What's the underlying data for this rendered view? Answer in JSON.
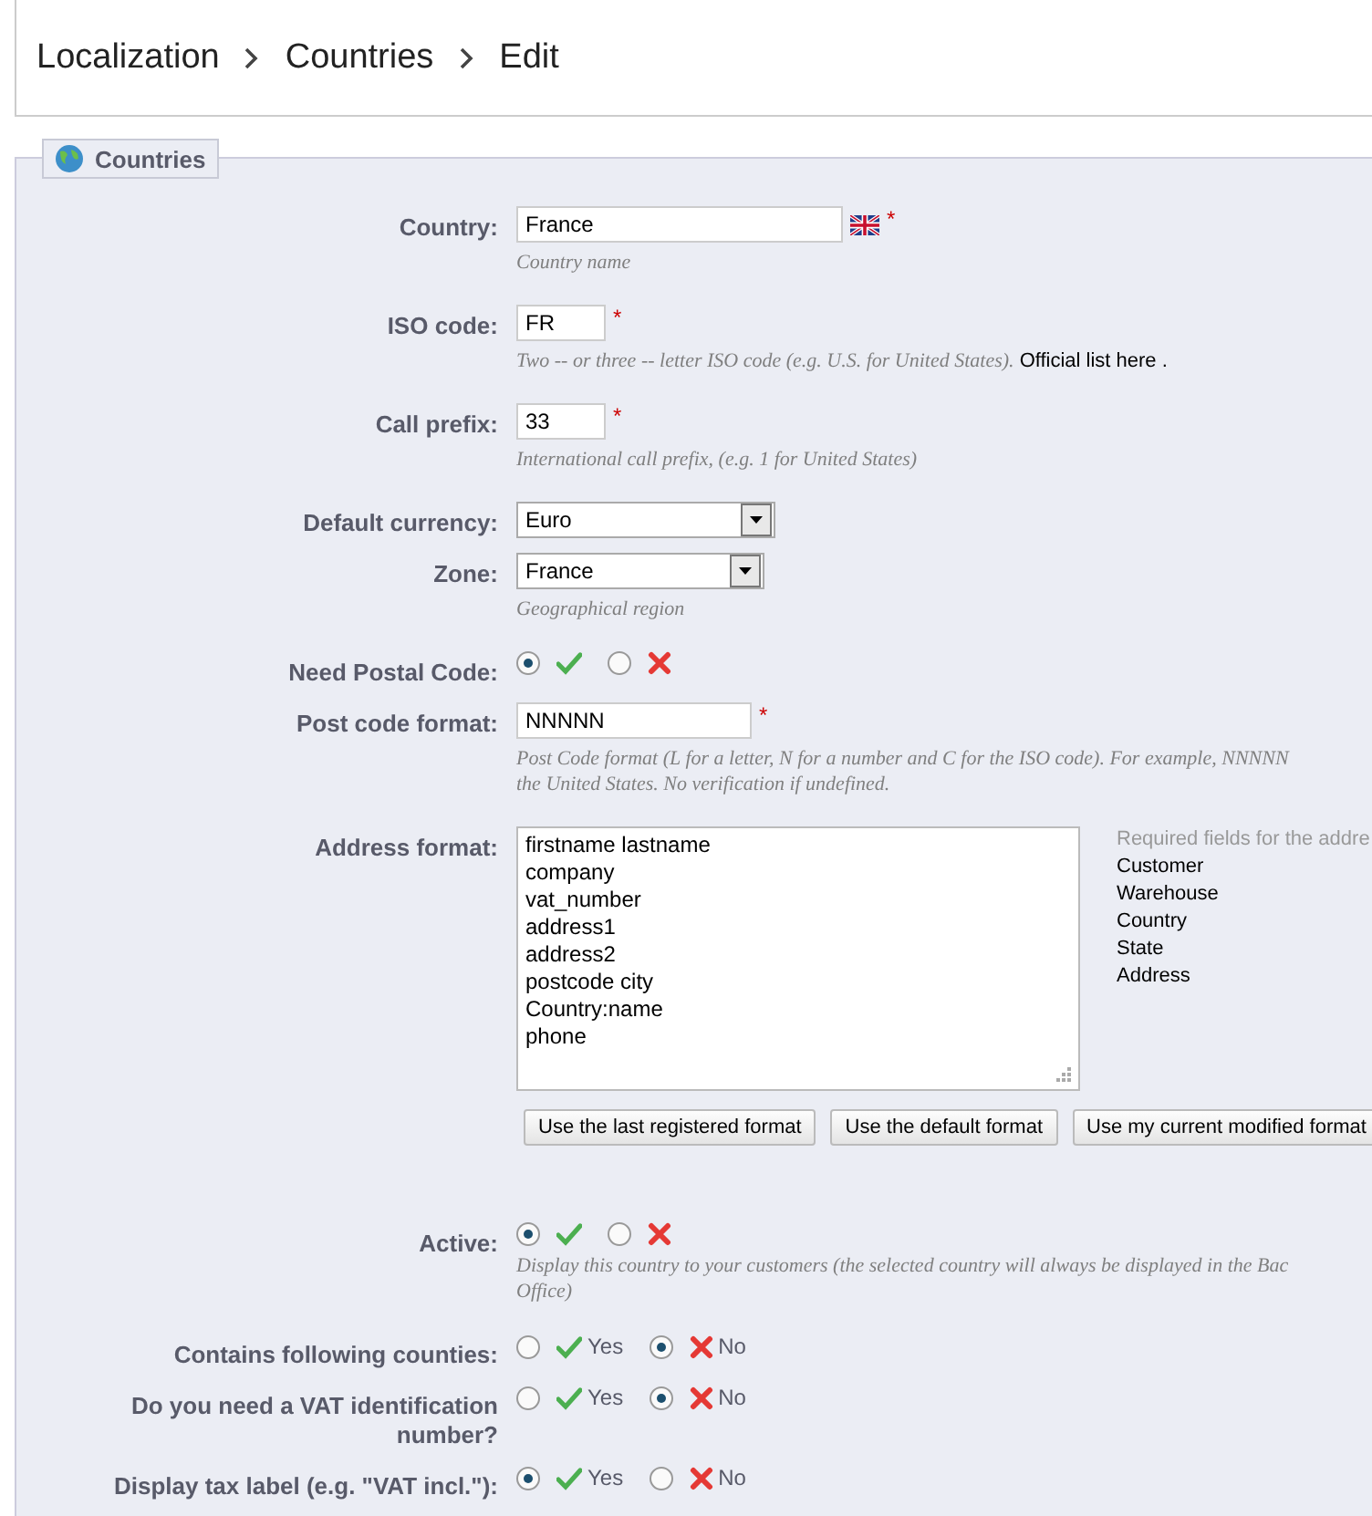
{
  "breadcrumb": [
    "Localization",
    "Countries",
    "Edit"
  ],
  "fieldset": {
    "legend": "Countries"
  },
  "fields": [
    {
      "kind": "text",
      "label": "Country:",
      "value": "France",
      "language_flag": true,
      "required": "*",
      "help": [
        "Country name"
      ]
    },
    {
      "kind": "text",
      "label": "ISO code:",
      "value": "FR",
      "required": "*",
      "help": [
        "Two -- or three -- letter ISO code (e.g. U.S. for United States)."
      ],
      "help_link": "Official list here ."
    },
    {
      "kind": "text",
      "label": "Call prefix:",
      "value": "33",
      "required": "*",
      "help": [
        "International call prefix, (e.g. 1 for United States)"
      ]
    },
    {
      "kind": "select",
      "label": "Default currency:",
      "value": "Euro"
    },
    {
      "kind": "select",
      "label": "Zone:",
      "value": "France",
      "help": [
        "Geographical region"
      ]
    },
    {
      "kind": "radio",
      "label": "Need Postal Code:",
      "options": [
        {
          "selected": true
        },
        {
          "selected": false
        }
      ]
    },
    {
      "kind": "text",
      "label": "Post code format:",
      "value": "NNNNN",
      "required": "*",
      "help": [
        "Post Code format (L for a letter, N for a number and C for the ISO code). For example, NNNNN",
        "the United States. No verification if undefined."
      ]
    },
    {
      "kind": "textarea",
      "label": "Address format:",
      "lines": [
        "firstname lastname",
        "company",
        "vat_number",
        "address1",
        "address2",
        "postcode city",
        "Country:name",
        "phone"
      ],
      "side_title": "Required fields for the addre",
      "side_items": [
        "Customer",
        "Warehouse",
        "Country",
        "State",
        "Address"
      ],
      "buttons": [
        "Use the last registered format",
        "Use the default format",
        "Use my current modified format"
      ]
    },
    {
      "kind": "radio",
      "label": "Active:",
      "options": [
        {
          "selected": true
        },
        {
          "selected": false
        }
      ],
      "help": [
        "Display this country to your customers (the selected country will always be displayed in the Bac",
        "Office)"
      ]
    },
    {
      "kind": "radio",
      "label": "Contains following counties:",
      "options": [
        {
          "label": "Yes",
          "selected": false
        },
        {
          "label": "No",
          "selected": true
        }
      ]
    },
    {
      "kind": "radio",
      "label": "Do you need a VAT identification number?",
      "options": [
        {
          "label": "Yes",
          "selected": false
        },
        {
          "label": "No",
          "selected": true
        }
      ]
    },
    {
      "kind": "radio",
      "label": "Display tax label (e.g. \"VAT incl.\"):",
      "options": [
        {
          "label": "Yes",
          "selected": true
        },
        {
          "label": "No",
          "selected": false
        }
      ]
    }
  ]
}
